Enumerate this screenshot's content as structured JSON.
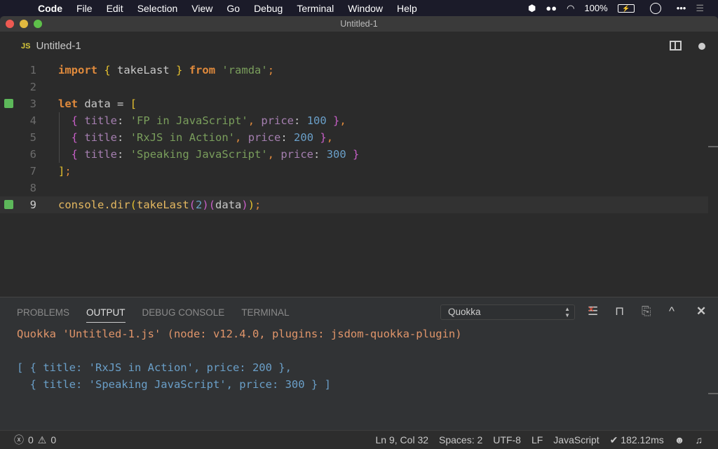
{
  "menubar": {
    "app": "Code",
    "items": [
      "File",
      "Edit",
      "Selection",
      "View",
      "Go",
      "Debug",
      "Terminal",
      "Window",
      "Help"
    ],
    "battery": "100%"
  },
  "window": {
    "title": "Untitled-1"
  },
  "tab": {
    "icon": "JS",
    "label": "Untitled-1"
  },
  "editor": {
    "current_line": 9,
    "lines": [
      {
        "n": "1",
        "mark": false,
        "tokens": [
          [
            "import",
            "#e08a3c",
            1
          ],
          [
            " ",
            "#ccc"
          ],
          [
            "{",
            "#e5c02e"
          ],
          [
            " takeLast ",
            "#c8c8c8"
          ],
          [
            "}",
            "#e5c02e"
          ],
          [
            " ",
            "#ccc"
          ],
          [
            "from",
            "#e08a3c",
            1
          ],
          [
            " ",
            "#ccc"
          ],
          [
            "'ramda'",
            "#7a9e5c"
          ],
          [
            ";",
            "#e08a3c"
          ]
        ]
      },
      {
        "n": "2",
        "mark": false,
        "tokens": []
      },
      {
        "n": "3",
        "mark": true,
        "tokens": [
          [
            "let",
            "#e08a3c",
            1
          ],
          [
            " data = ",
            "#c8c8c8"
          ],
          [
            "[",
            "#e5c02e"
          ]
        ]
      },
      {
        "n": "4",
        "mark": false,
        "tokens": [
          [
            "  ",
            "#ccc"
          ],
          [
            "{",
            "#c85fc8"
          ],
          [
            " ",
            "#ccc"
          ],
          [
            "title",
            "#a57fb0"
          ],
          [
            ": ",
            "#c8c8c8"
          ],
          [
            "'FP in JavaScript'",
            "#7a9e5c"
          ],
          [
            ", ",
            "#e08a3c"
          ],
          [
            "price",
            "#a57fb0"
          ],
          [
            ": ",
            "#c8c8c8"
          ],
          [
            "100",
            "#6a9fc8"
          ],
          [
            " ",
            "#ccc"
          ],
          [
            "}",
            "#c85fc8"
          ],
          [
            ",",
            "#e08a3c"
          ]
        ]
      },
      {
        "n": "5",
        "mark": false,
        "tokens": [
          [
            "  ",
            "#ccc"
          ],
          [
            "{",
            "#c85fc8"
          ],
          [
            " ",
            "#ccc"
          ],
          [
            "title",
            "#a57fb0"
          ],
          [
            ": ",
            "#c8c8c8"
          ],
          [
            "'RxJS in Action'",
            "#7a9e5c"
          ],
          [
            ", ",
            "#e08a3c"
          ],
          [
            "price",
            "#a57fb0"
          ],
          [
            ": ",
            "#c8c8c8"
          ],
          [
            "200",
            "#6a9fc8"
          ],
          [
            " ",
            "#ccc"
          ],
          [
            "}",
            "#c85fc8"
          ],
          [
            ",",
            "#e08a3c"
          ]
        ]
      },
      {
        "n": "6",
        "mark": false,
        "tokens": [
          [
            "  ",
            "#ccc"
          ],
          [
            "{",
            "#c85fc8"
          ],
          [
            " ",
            "#ccc"
          ],
          [
            "title",
            "#a57fb0"
          ],
          [
            ": ",
            "#c8c8c8"
          ],
          [
            "'Speaking JavaScript'",
            "#7a9e5c"
          ],
          [
            ", ",
            "#e08a3c"
          ],
          [
            "price",
            "#a57fb0"
          ],
          [
            ": ",
            "#c8c8c8"
          ],
          [
            "300",
            "#6a9fc8"
          ],
          [
            " ",
            "#ccc"
          ],
          [
            "}",
            "#c85fc8"
          ]
        ]
      },
      {
        "n": "7",
        "mark": false,
        "tokens": [
          [
            "]",
            "#e5c02e"
          ],
          [
            ";",
            "#e08a3c"
          ]
        ]
      },
      {
        "n": "8",
        "mark": false,
        "tokens": []
      },
      {
        "n": "9",
        "mark": true,
        "tokens": [
          [
            "console.dir",
            "#e5b860"
          ],
          [
            "(",
            "#e5c02e"
          ],
          [
            "takeLast",
            "#e5b860"
          ],
          [
            "(",
            "#c85fc8"
          ],
          [
            "2",
            "#6a9fc8"
          ],
          [
            ")",
            "#c85fc8"
          ],
          [
            "(",
            "#c85fc8"
          ],
          [
            "data",
            "#c8c8c8"
          ],
          [
            ")",
            "#c85fc8"
          ],
          [
            ")",
            "#e5c02e"
          ],
          [
            ";",
            "#e08a3c"
          ]
        ]
      }
    ]
  },
  "panel": {
    "tabs": [
      "PROBLEMS",
      "OUTPUT",
      "DEBUG CONSOLE",
      "TERMINAL"
    ],
    "active_tab": "OUTPUT",
    "channel": "Quokka",
    "output": {
      "header": "Quokka 'Untitled-1.js' (node: v12.4.0, plugins: jsdom-quokka-plugin)",
      "result_1": "[ { title: 'RxJS in Action', price: 200 },",
      "result_2": "  { title: 'Speaking JavaScript', price: 300 } ]"
    }
  },
  "status": {
    "errors": "0",
    "warnings": "0",
    "position": "Ln 9, Col 32",
    "spaces": "Spaces: 2",
    "encoding": "UTF-8",
    "eol": "LF",
    "language": "JavaScript",
    "timing": "✔ 182.12ms"
  },
  "colors": {
    "accent_orange": "#e08a3c",
    "output_header": "#e0956a",
    "output_result": "#6a9fc8",
    "gutter_mark": "#5db85a"
  }
}
